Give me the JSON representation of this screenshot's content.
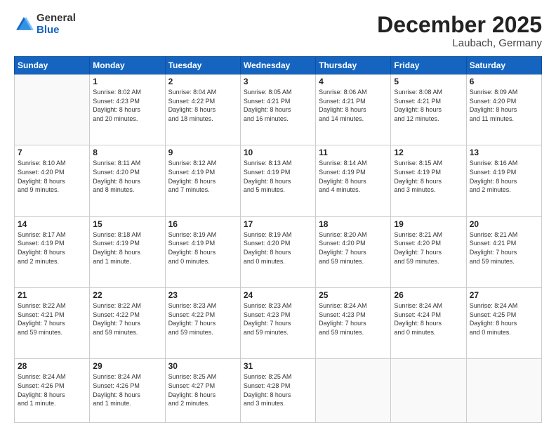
{
  "header": {
    "logo": {
      "general": "General",
      "blue": "Blue"
    },
    "title": "December 2025",
    "subtitle": "Laubach, Germany"
  },
  "days_of_week": [
    "Sunday",
    "Monday",
    "Tuesday",
    "Wednesday",
    "Thursday",
    "Friday",
    "Saturday"
  ],
  "weeks": [
    [
      {
        "num": "",
        "info": ""
      },
      {
        "num": "1",
        "info": "Sunrise: 8:02 AM\nSunset: 4:23 PM\nDaylight: 8 hours\nand 20 minutes."
      },
      {
        "num": "2",
        "info": "Sunrise: 8:04 AM\nSunset: 4:22 PM\nDaylight: 8 hours\nand 18 minutes."
      },
      {
        "num": "3",
        "info": "Sunrise: 8:05 AM\nSunset: 4:21 PM\nDaylight: 8 hours\nand 16 minutes."
      },
      {
        "num": "4",
        "info": "Sunrise: 8:06 AM\nSunset: 4:21 PM\nDaylight: 8 hours\nand 14 minutes."
      },
      {
        "num": "5",
        "info": "Sunrise: 8:08 AM\nSunset: 4:21 PM\nDaylight: 8 hours\nand 12 minutes."
      },
      {
        "num": "6",
        "info": "Sunrise: 8:09 AM\nSunset: 4:20 PM\nDaylight: 8 hours\nand 11 minutes."
      }
    ],
    [
      {
        "num": "7",
        "info": "Sunrise: 8:10 AM\nSunset: 4:20 PM\nDaylight: 8 hours\nand 9 minutes."
      },
      {
        "num": "8",
        "info": "Sunrise: 8:11 AM\nSunset: 4:20 PM\nDaylight: 8 hours\nand 8 minutes."
      },
      {
        "num": "9",
        "info": "Sunrise: 8:12 AM\nSunset: 4:19 PM\nDaylight: 8 hours\nand 7 minutes."
      },
      {
        "num": "10",
        "info": "Sunrise: 8:13 AM\nSunset: 4:19 PM\nDaylight: 8 hours\nand 5 minutes."
      },
      {
        "num": "11",
        "info": "Sunrise: 8:14 AM\nSunset: 4:19 PM\nDaylight: 8 hours\nand 4 minutes."
      },
      {
        "num": "12",
        "info": "Sunrise: 8:15 AM\nSunset: 4:19 PM\nDaylight: 8 hours\nand 3 minutes."
      },
      {
        "num": "13",
        "info": "Sunrise: 8:16 AM\nSunset: 4:19 PM\nDaylight: 8 hours\nand 2 minutes."
      }
    ],
    [
      {
        "num": "14",
        "info": "Sunrise: 8:17 AM\nSunset: 4:19 PM\nDaylight: 8 hours\nand 2 minutes."
      },
      {
        "num": "15",
        "info": "Sunrise: 8:18 AM\nSunset: 4:19 PM\nDaylight: 8 hours\nand 1 minute."
      },
      {
        "num": "16",
        "info": "Sunrise: 8:19 AM\nSunset: 4:19 PM\nDaylight: 8 hours\nand 0 minutes."
      },
      {
        "num": "17",
        "info": "Sunrise: 8:19 AM\nSunset: 4:20 PM\nDaylight: 8 hours\nand 0 minutes."
      },
      {
        "num": "18",
        "info": "Sunrise: 8:20 AM\nSunset: 4:20 PM\nDaylight: 7 hours\nand 59 minutes."
      },
      {
        "num": "19",
        "info": "Sunrise: 8:21 AM\nSunset: 4:20 PM\nDaylight: 7 hours\nand 59 minutes."
      },
      {
        "num": "20",
        "info": "Sunrise: 8:21 AM\nSunset: 4:21 PM\nDaylight: 7 hours\nand 59 minutes."
      }
    ],
    [
      {
        "num": "21",
        "info": "Sunrise: 8:22 AM\nSunset: 4:21 PM\nDaylight: 7 hours\nand 59 minutes."
      },
      {
        "num": "22",
        "info": "Sunrise: 8:22 AM\nSunset: 4:22 PM\nDaylight: 7 hours\nand 59 minutes."
      },
      {
        "num": "23",
        "info": "Sunrise: 8:23 AM\nSunset: 4:22 PM\nDaylight: 7 hours\nand 59 minutes."
      },
      {
        "num": "24",
        "info": "Sunrise: 8:23 AM\nSunset: 4:23 PM\nDaylight: 7 hours\nand 59 minutes."
      },
      {
        "num": "25",
        "info": "Sunrise: 8:24 AM\nSunset: 4:23 PM\nDaylight: 7 hours\nand 59 minutes."
      },
      {
        "num": "26",
        "info": "Sunrise: 8:24 AM\nSunset: 4:24 PM\nDaylight: 8 hours\nand 0 minutes."
      },
      {
        "num": "27",
        "info": "Sunrise: 8:24 AM\nSunset: 4:25 PM\nDaylight: 8 hours\nand 0 minutes."
      }
    ],
    [
      {
        "num": "28",
        "info": "Sunrise: 8:24 AM\nSunset: 4:26 PM\nDaylight: 8 hours\nand 1 minute."
      },
      {
        "num": "29",
        "info": "Sunrise: 8:24 AM\nSunset: 4:26 PM\nDaylight: 8 hours\nand 1 minute."
      },
      {
        "num": "30",
        "info": "Sunrise: 8:25 AM\nSunset: 4:27 PM\nDaylight: 8 hours\nand 2 minutes."
      },
      {
        "num": "31",
        "info": "Sunrise: 8:25 AM\nSunset: 4:28 PM\nDaylight: 8 hours\nand 3 minutes."
      },
      {
        "num": "",
        "info": ""
      },
      {
        "num": "",
        "info": ""
      },
      {
        "num": "",
        "info": ""
      }
    ]
  ]
}
